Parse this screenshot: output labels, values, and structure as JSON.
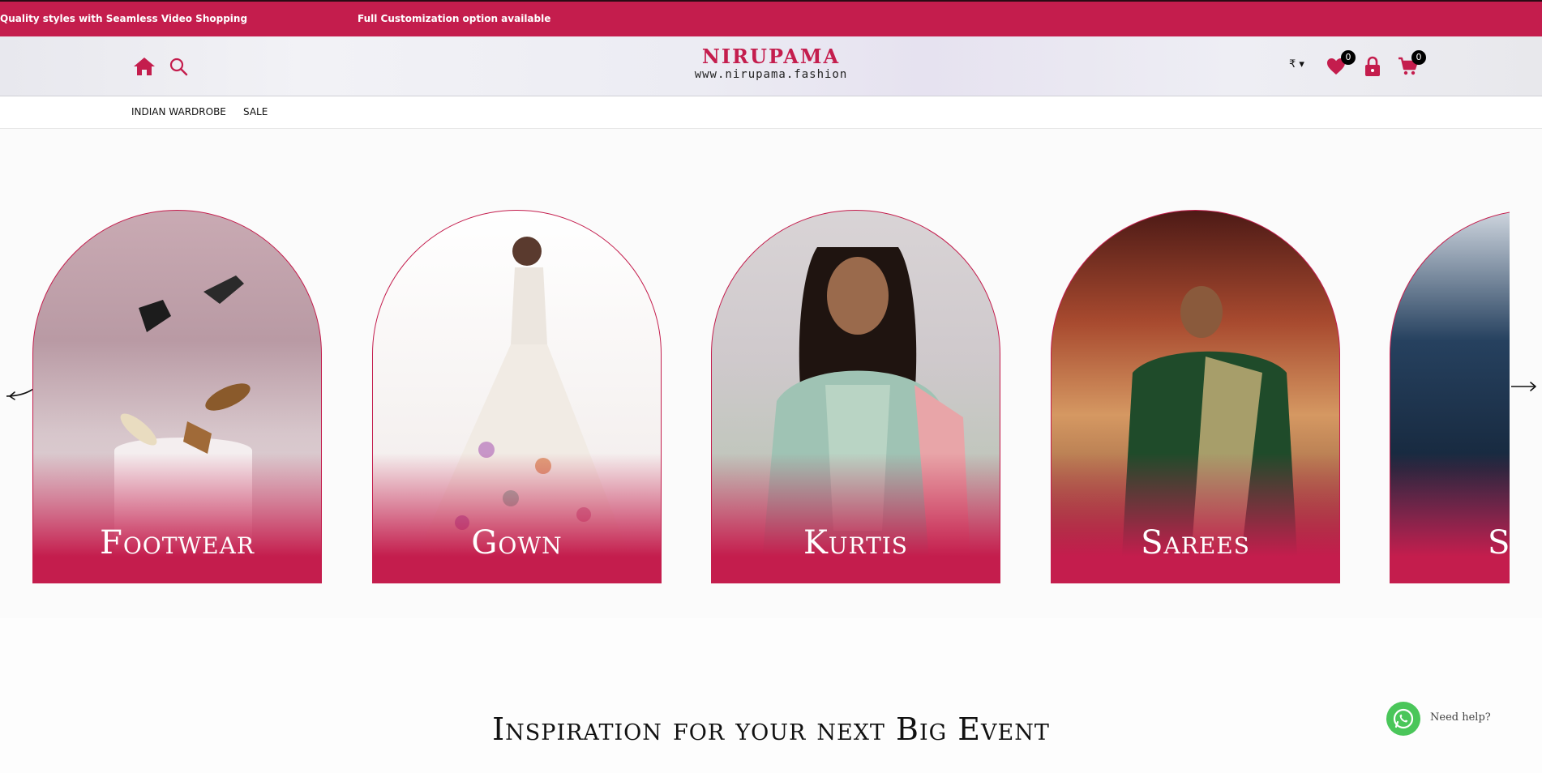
{
  "announcement": {
    "message1": "Quality styles with Seamless Video Shopping",
    "message2": "Full Customization option available"
  },
  "header": {
    "brand": "NIRUPAMA",
    "url": "www.nirupama.fashion",
    "currency": "₹ ▾",
    "wishlist_count": "0",
    "cart_count": "0",
    "icons": [
      "home-icon",
      "search-icon",
      "heart-icon",
      "lock-icon",
      "cart-icon"
    ]
  },
  "nav": {
    "items": [
      {
        "label": "INDIAN WARDROBE"
      },
      {
        "label": "SALE"
      }
    ]
  },
  "categories": [
    {
      "label": "Footwear"
    },
    {
      "label": "Gown"
    },
    {
      "label": "Kurtis"
    },
    {
      "label": "Sarees"
    },
    {
      "label": "S"
    }
  ],
  "section": {
    "heading": "Inspiration for your next Big Event"
  },
  "help": {
    "label": "Need help?"
  },
  "colors": {
    "brand": "#c41d4d",
    "whatsapp": "#4ac65a"
  }
}
